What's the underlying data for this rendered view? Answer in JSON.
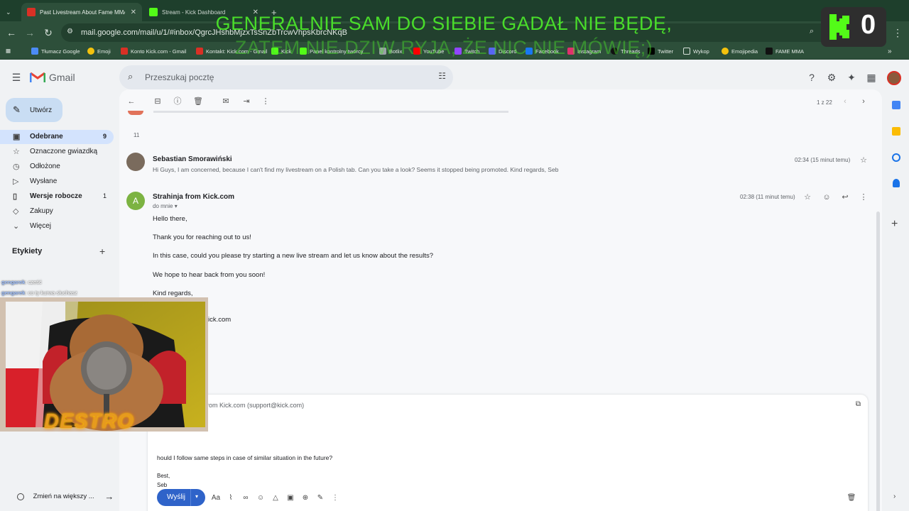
{
  "browser": {
    "tabs": [
      {
        "label": "Past Livestream About Fame MMA co",
        "active": true
      },
      {
        "label": "Stream - Kick Dashboard",
        "active": false
      }
    ],
    "url": "mail.google.com/mail/u/1/#inbox/QgrcJHshbMjzxTsSnZbTrcwVhpsKbrcNKqB",
    "bookmarks": [
      "Tłumacz Google",
      "Emoji",
      "Konto Kick.com - Gmail",
      "Kontakt: Kick.com - Gmail",
      "Kick",
      "Panel kontrolny twórcy",
      "Botlix",
      "YouTube",
      "Twitch",
      "Discord",
      "Facebook",
      "Instagram",
      "Threads",
      "Twitter",
      "Wykop",
      "Emojipedia",
      "FAME MMA"
    ]
  },
  "gmail": {
    "brand": "Gmail",
    "search_placeholder": "Przeszukaj pocztę",
    "compose_label": "Utwórz",
    "nav": [
      {
        "label": "Odebrane",
        "count": "9",
        "icon": "inbox-icon"
      },
      {
        "label": "Oznaczone gwiazdką",
        "count": "",
        "icon": "star-icon"
      },
      {
        "label": "Odłożone",
        "count": "",
        "icon": "clock-icon"
      },
      {
        "label": "Wysłane",
        "count": "",
        "icon": "send-icon"
      },
      {
        "label": "Wersje robocze",
        "count": "1",
        "icon": "draft-icon"
      },
      {
        "label": "Zakupy",
        "count": "",
        "icon": "tag-icon"
      },
      {
        "label": "Więcej",
        "count": "",
        "icon": "chevron-down-icon"
      }
    ],
    "labels_header": "Etykiety",
    "pagination": "1 z 22",
    "collapsed_count": "11",
    "messages": [
      {
        "sender": "Sebastian Smorawiński",
        "snippet": "Hi Guys, I am concerned, because I can't find my livestream on a Polish tab. Can you take a look? Seems it stopped being promoted. Kind regards, Seb",
        "time": "02:34 (15 minut temu)"
      },
      {
        "sender": "Strahinja from Kick.com",
        "avatar_letter": "A",
        "to": "do mnie",
        "time": "02:38 (11 minut temu)",
        "body": [
          "Hello there,",
          "Thank you for reaching out to us!",
          "In this case, could you please try starting a new live stream and let us know about the results?",
          "We hope to hear back from you soon!",
          "Kind regards,",
          "ick.com"
        ]
      }
    ],
    "reply": {
      "to": "rom Kick.com (support@kick.com)",
      "line": "hould I follow same steps in case of similar situation in the future?",
      "sign1": "Best,",
      "sign2": "Seb",
      "send_label": "Wyślij"
    },
    "bottom_hint": "Zmień na większy ..."
  },
  "overlay": {
    "caption_line1": "GENERALNIE SAM DO SIEBIE GADAŁ NIE BĘDĘ,",
    "caption_line2": "ZATEM NIE DZIW RYJA, ŻE NIC NIE MÓWIĘ;)",
    "viewer_count": "0",
    "chat": [
      {
        "user": "gengarek",
        "text": "cześć"
      },
      {
        "user": "gengarek",
        "text": "co ty kurwa słuchasz"
      }
    ],
    "webcam_logo": "DESTRO"
  },
  "colors": {
    "browser_dark": "#1e3f2c",
    "browser_mid": "#2d4f3a",
    "caption_green": "#49dd2a",
    "kick_green": "#53fc18",
    "gmail_blue": "#2f63c9"
  }
}
